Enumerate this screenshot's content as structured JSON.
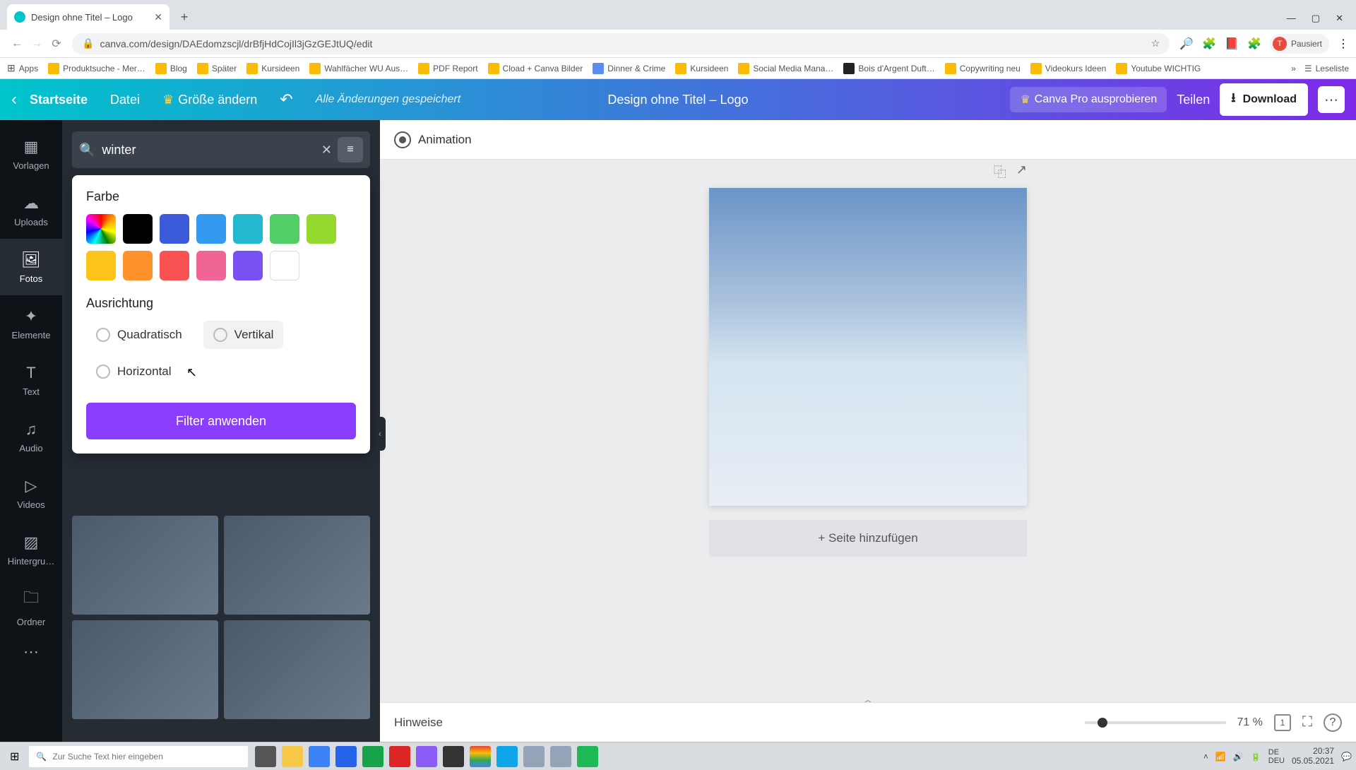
{
  "browser": {
    "tab_title": "Design ohne Titel – Logo",
    "new_tab": "+",
    "url": "canva.com/design/DAEdomzscjl/drBfjHdCojIl3jGzGEJtUQ/edit",
    "profile_initial": "T",
    "profile_label": "Pausiert",
    "win_min": "—",
    "win_max": "▢",
    "win_close": "✕",
    "back": "←",
    "fwd": "→",
    "reload": "⟳",
    "lock": "🔒",
    "star": "☆"
  },
  "bookmarks": {
    "apps": "Apps",
    "items": [
      "Produktsuche - Mer…",
      "Blog",
      "Später",
      "Kursideen",
      "Wahlfächer WU Aus…",
      "PDF Report",
      "Cload + Canva Bilder",
      "Dinner & Crime",
      "Kursideen",
      "Social Media Mana…",
      "Bois d'Argent Duft…",
      "Copywriting neu",
      "Videokurs Ideen",
      "Youtube WICHTIG"
    ],
    "overflow": "»",
    "readlist": "Leseliste"
  },
  "header": {
    "back": "‹",
    "home": "Startseite",
    "file": "Datei",
    "resize": "Größe ändern",
    "undo": "↶",
    "saved": "Alle Änderungen gespeichert",
    "doc_title": "Design ohne Titel – Logo",
    "pro": "Canva Pro ausprobieren",
    "share": "Teilen",
    "download": "Download",
    "download_icon": "⭳",
    "more": "⋯"
  },
  "rail": {
    "items": [
      {
        "icon": "▦",
        "label": "Vorlagen"
      },
      {
        "icon": "☁",
        "label": "Uploads"
      },
      {
        "icon": "🖼",
        "label": "Fotos"
      },
      {
        "icon": "✦",
        "label": "Elemente"
      },
      {
        "icon": "T",
        "label": "Text"
      },
      {
        "icon": "♫",
        "label": "Audio"
      },
      {
        "icon": "▷",
        "label": "Videos"
      },
      {
        "icon": "▨",
        "label": "Hintergru…"
      },
      {
        "icon": "🗀",
        "label": "Ordner"
      },
      {
        "icon": "⋯",
        "label": ""
      }
    ],
    "active_index": 2
  },
  "search": {
    "value": "winter",
    "icon": "🔍",
    "clear": "✕",
    "filter": "≡"
  },
  "filter_popover": {
    "color_heading": "Farbe",
    "colors": [
      "rainbow",
      "#000000",
      "#3b5bdb",
      "#339af0",
      "#22b8cf",
      "#51cf66",
      "#94d82d",
      "#fcc419",
      "#ff922b",
      "#fa5252",
      "#f06595",
      "#7950f2",
      "#ffffff"
    ],
    "orient_heading": "Ausrichtung",
    "options": [
      "Quadratisch",
      "Vertikal",
      "Horizontal"
    ],
    "apply": "Filter anwenden"
  },
  "canvas": {
    "animation": "Animation",
    "dup_icon": "⿻",
    "share_icon": "↗",
    "add_page": "+ Seite hinzufügen",
    "collapse": "‹",
    "hints": "Hinweise",
    "zoom_pct": "71 %",
    "grid_icon": "▢",
    "full_icon": "⛶",
    "help_icon": "?",
    "page_up": "︿"
  },
  "taskbar": {
    "start": "⊞",
    "search_placeholder": "Zur Suche Text hier eingeben",
    "lang": "DE\nDEU",
    "time": "20:37",
    "date": "05.05.2021",
    "notif": "💬"
  }
}
